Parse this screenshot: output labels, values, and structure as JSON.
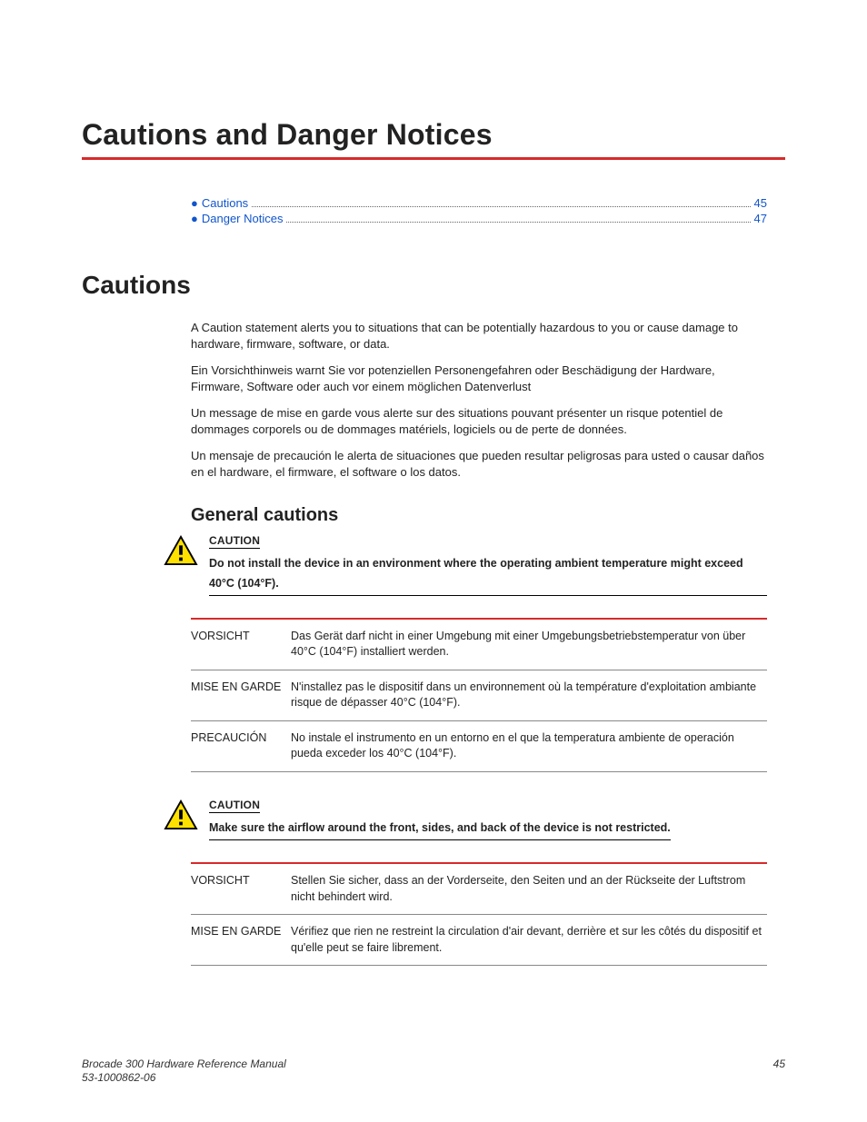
{
  "chapter_title": "Cautions and Danger Notices",
  "toc": [
    {
      "label": "Cautions",
      "page": "45"
    },
    {
      "label": "Danger Notices",
      "page": "47"
    }
  ],
  "section1_title": "Cautions",
  "intro_paras": [
    "A Caution statement alerts you to situations that can be potentially hazardous to you or cause damage to hardware, firmware, software, or data.",
    "Ein Vorsichthinweis warnt Sie vor potenziellen Personengefahren oder Beschädigung der Hardware, Firmware, Software oder auch vor einem möglichen Datenverlust",
    "Un message de mise en garde vous alerte sur des situations pouvant présenter un risque potentiel de dommages corporels ou de dommages matériels, logiciels ou de perte de données.",
    "Un mensaje de precaución le alerta de situaciones que pueden resultar peligrosas para usted o causar daños en el hardware, el firmware, el software o los datos."
  ],
  "subsection_title": "General cautions",
  "cautions": [
    {
      "label": "CAUTION",
      "text": "Do not install the device in an environment where the operating ambient temperature might exceed 40°C (104°F).",
      "translations": [
        {
          "lang": "VORSICHT",
          "text": "Das Gerät darf nicht in einer Umgebung mit einer Umgebungsbetriebstemperatur von über 40°C (104°F) installiert werden."
        },
        {
          "lang": "MISE EN GARDE",
          "text": "N'installez pas le dispositif dans un environnement où la température d'exploitation ambiante risque de dépasser 40°C (104°F)."
        },
        {
          "lang": "PRECAUCIÓN",
          "text": "No instale el instrumento en un entorno en el que la temperatura ambiente de operación pueda exceder los 40°C (104°F)."
        }
      ]
    },
    {
      "label": "CAUTION",
      "text": "Make sure the airflow around the front, sides, and back of the device is not restricted.",
      "translations": [
        {
          "lang": "VORSICHT",
          "text": "Stellen Sie sicher, dass an der Vorderseite, den Seiten und an der Rückseite der Luftstrom nicht behindert wird."
        },
        {
          "lang": "MISE EN GARDE",
          "text": "Vérifiez que rien ne restreint la circulation d'air devant, derrière et sur les côtés du dispositif et qu'elle peut se faire librement."
        }
      ]
    }
  ],
  "footer": {
    "title": "Brocade 300 Hardware Reference Manual",
    "docnum": "53-1000862-06",
    "page": "45"
  }
}
